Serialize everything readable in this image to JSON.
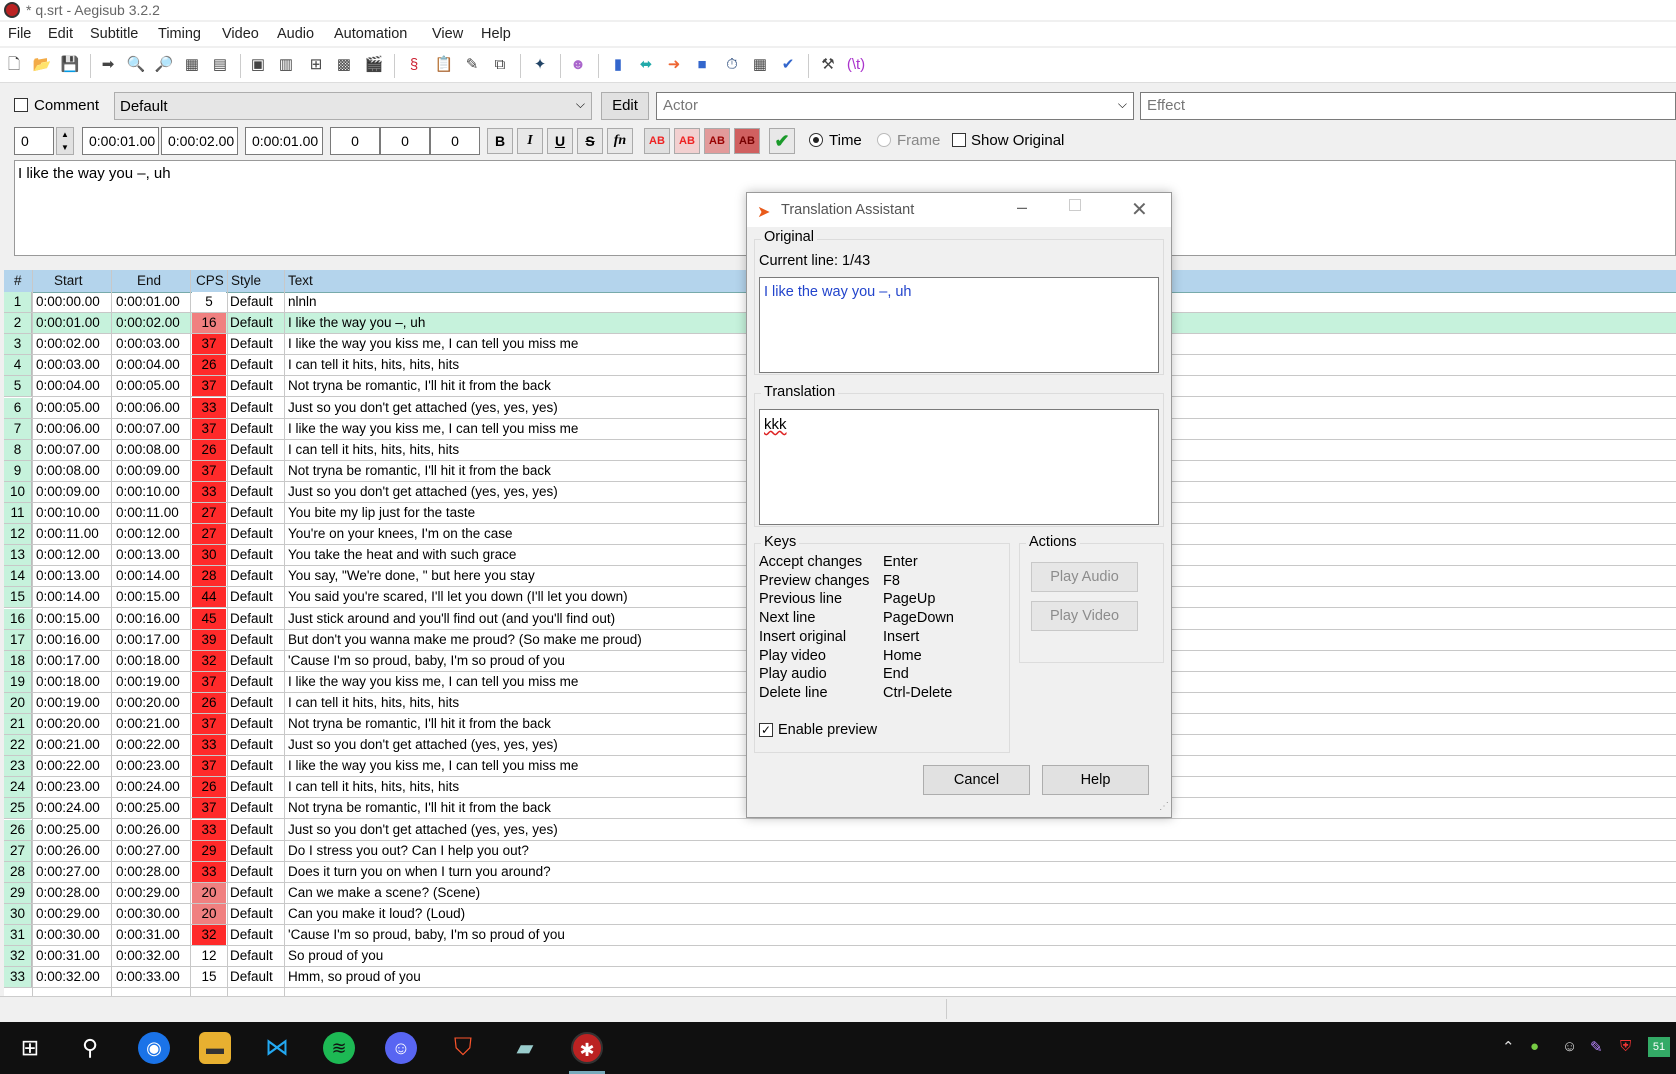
{
  "window": {
    "title": "* q.srt - Aegisub 3.2.2"
  },
  "menu": [
    "File",
    "Edit",
    "Subtitle",
    "Timing",
    "Video",
    "Audio",
    "Automation",
    "View",
    "Help"
  ],
  "editor": {
    "comment_label": "Comment",
    "style_value": "Default",
    "edit_button": "Edit",
    "actor_placeholder": "Actor",
    "effect_placeholder": "Effect",
    "layer": "0",
    "start_time": "0:00:01.00",
    "end_time": "0:00:02.00",
    "duration": "0:00:01.00",
    "margin_l": "0",
    "margin_r": "0",
    "margin_v": "0",
    "bold": "B",
    "italic": "I",
    "underline": "U",
    "strike": "S",
    "fn": "fn",
    "ab": "AB",
    "time_label": "Time",
    "frame_label": "Frame",
    "show_original_label": "Show Original",
    "text": "I like the way you –, uh"
  },
  "grid": {
    "headers": {
      "num": "#",
      "start": "Start",
      "end": "End",
      "cps": "CPS",
      "style": "Style",
      "text": "Text"
    },
    "rows": [
      {
        "n": "1",
        "s": "0:00:00.00",
        "e": "0:00:01.00",
        "c": "5",
        "st": "Default",
        "t": "nlnln"
      },
      {
        "n": "2",
        "s": "0:00:01.00",
        "e": "0:00:02.00",
        "c": "16",
        "st": "Default",
        "t": "I like the way you –, uh"
      },
      {
        "n": "3",
        "s": "0:00:02.00",
        "e": "0:00:03.00",
        "c": "37",
        "st": "Default",
        "t": "I like the way you kiss me, I can tell you miss me"
      },
      {
        "n": "4",
        "s": "0:00:03.00",
        "e": "0:00:04.00",
        "c": "26",
        "st": "Default",
        "t": "I can tell it hits, hits, hits, hits"
      },
      {
        "n": "5",
        "s": "0:00:04.00",
        "e": "0:00:05.00",
        "c": "37",
        "st": "Default",
        "t": "Not tryna be romantic, I'll hit it from the back"
      },
      {
        "n": "6",
        "s": "0:00:05.00",
        "e": "0:00:06.00",
        "c": "33",
        "st": "Default",
        "t": "Just so you don't get attached (yes, yes, yes)"
      },
      {
        "n": "7",
        "s": "0:00:06.00",
        "e": "0:00:07.00",
        "c": "37",
        "st": "Default",
        "t": "I like the way you kiss me, I can tell you miss me"
      },
      {
        "n": "8",
        "s": "0:00:07.00",
        "e": "0:00:08.00",
        "c": "26",
        "st": "Default",
        "t": "I can tell it hits, hits, hits, hits"
      },
      {
        "n": "9",
        "s": "0:00:08.00",
        "e": "0:00:09.00",
        "c": "37",
        "st": "Default",
        "t": "Not tryna be romantic, I'll hit it from the back"
      },
      {
        "n": "10",
        "s": "0:00:09.00",
        "e": "0:00:10.00",
        "c": "33",
        "st": "Default",
        "t": "Just so you don't get attached (yes, yes, yes)"
      },
      {
        "n": "11",
        "s": "0:00:10.00",
        "e": "0:00:11.00",
        "c": "27",
        "st": "Default",
        "t": "You bite my lip just for the taste"
      },
      {
        "n": "12",
        "s": "0:00:11.00",
        "e": "0:00:12.00",
        "c": "27",
        "st": "Default",
        "t": "You're on your knees, I'm on the case"
      },
      {
        "n": "13",
        "s": "0:00:12.00",
        "e": "0:00:13.00",
        "c": "30",
        "st": "Default",
        "t": "You take the heat and with such grace"
      },
      {
        "n": "14",
        "s": "0:00:13.00",
        "e": "0:00:14.00",
        "c": "28",
        "st": "Default",
        "t": "You say, \"We're done, \" but here you stay"
      },
      {
        "n": "15",
        "s": "0:00:14.00",
        "e": "0:00:15.00",
        "c": "44",
        "st": "Default",
        "t": "You said you're scared, I'll let you down (I'll let you down)"
      },
      {
        "n": "16",
        "s": "0:00:15.00",
        "e": "0:00:16.00",
        "c": "45",
        "st": "Default",
        "t": "Just stick around and you'll find out (and you'll find out)"
      },
      {
        "n": "17",
        "s": "0:00:16.00",
        "e": "0:00:17.00",
        "c": "39",
        "st": "Default",
        "t": "But don't you wanna make me proud? (So make me proud)"
      },
      {
        "n": "18",
        "s": "0:00:17.00",
        "e": "0:00:18.00",
        "c": "32",
        "st": "Default",
        "t": "'Cause I'm so proud, baby, I'm so proud of you"
      },
      {
        "n": "19",
        "s": "0:00:18.00",
        "e": "0:00:19.00",
        "c": "37",
        "st": "Default",
        "t": "I like the way you kiss me, I can tell you miss me"
      },
      {
        "n": "20",
        "s": "0:00:19.00",
        "e": "0:00:20.00",
        "c": "26",
        "st": "Default",
        "t": "I can tell it hits, hits, hits, hits"
      },
      {
        "n": "21",
        "s": "0:00:20.00",
        "e": "0:00:21.00",
        "c": "37",
        "st": "Default",
        "t": "Not tryna be romantic, I'll hit it from the back"
      },
      {
        "n": "22",
        "s": "0:00:21.00",
        "e": "0:00:22.00",
        "c": "33",
        "st": "Default",
        "t": "Just so you don't get attached (yes, yes, yes)"
      },
      {
        "n": "23",
        "s": "0:00:22.00",
        "e": "0:00:23.00",
        "c": "37",
        "st": "Default",
        "t": "I like the way you kiss me, I can tell you miss me"
      },
      {
        "n": "24",
        "s": "0:00:23.00",
        "e": "0:00:24.00",
        "c": "26",
        "st": "Default",
        "t": "I can tell it hits, hits, hits, hits"
      },
      {
        "n": "25",
        "s": "0:00:24.00",
        "e": "0:00:25.00",
        "c": "37",
        "st": "Default",
        "t": "Not tryna be romantic, I'll hit it from the back"
      },
      {
        "n": "26",
        "s": "0:00:25.00",
        "e": "0:00:26.00",
        "c": "33",
        "st": "Default",
        "t": "Just so you don't get attached (yes, yes, yes)"
      },
      {
        "n": "27",
        "s": "0:00:26.00",
        "e": "0:00:27.00",
        "c": "29",
        "st": "Default",
        "t": "Do I stress you out? Can I help you out?"
      },
      {
        "n": "28",
        "s": "0:00:27.00",
        "e": "0:00:28.00",
        "c": "33",
        "st": "Default",
        "t": "Does it turn you on when I turn you around?"
      },
      {
        "n": "29",
        "s": "0:00:28.00",
        "e": "0:00:29.00",
        "c": "20",
        "st": "Default",
        "t": "Can we make a scene? (Scene)"
      },
      {
        "n": "30",
        "s": "0:00:29.00",
        "e": "0:00:30.00",
        "c": "20",
        "st": "Default",
        "t": "Can you make it loud? (Loud)"
      },
      {
        "n": "31",
        "s": "0:00:30.00",
        "e": "0:00:31.00",
        "c": "32",
        "st": "Default",
        "t": "'Cause I'm so proud, baby, I'm so proud of you"
      },
      {
        "n": "32",
        "s": "0:00:31.00",
        "e": "0:00:32.00",
        "c": "12",
        "st": "Default",
        "t": "So proud of you"
      },
      {
        "n": "33",
        "s": "0:00:32.00",
        "e": "0:00:33.00",
        "c": "15",
        "st": "Default",
        "t": "Hmm, so proud of you"
      }
    ]
  },
  "dialog": {
    "title": "Translation Assistant",
    "original_label": "Original",
    "current_line": "Current line: 1/43",
    "original_text": "I like the way you –, uh",
    "translation_label": "Translation",
    "translation_text": "kkk",
    "keys_label": "Keys",
    "keys": [
      {
        "action": "Accept changes",
        "key": "Enter"
      },
      {
        "action": "Preview changes",
        "key": "F8"
      },
      {
        "action": "Previous line",
        "key": "PageUp"
      },
      {
        "action": "Next line",
        "key": "PageDown"
      },
      {
        "action": "Insert original",
        "key": "Insert"
      },
      {
        "action": "Play video",
        "key": "Home"
      },
      {
        "action": "Play audio",
        "key": "End"
      },
      {
        "action": "Delete line",
        "key": "Ctrl-Delete"
      }
    ],
    "actions_label": "Actions",
    "play_audio": "Play Audio",
    "play_video": "Play Video",
    "enable_preview": "Enable preview",
    "cancel": "Cancel",
    "help": "Help"
  },
  "taskbar": {
    "tray_badge": "51"
  },
  "colors": {
    "cps_high": "#ff2a2a",
    "cps_mid": "#f08080",
    "cps_low": "#ffffff",
    "selected_row": "#c6f2dc",
    "grid_header": "#b4d4ec"
  }
}
